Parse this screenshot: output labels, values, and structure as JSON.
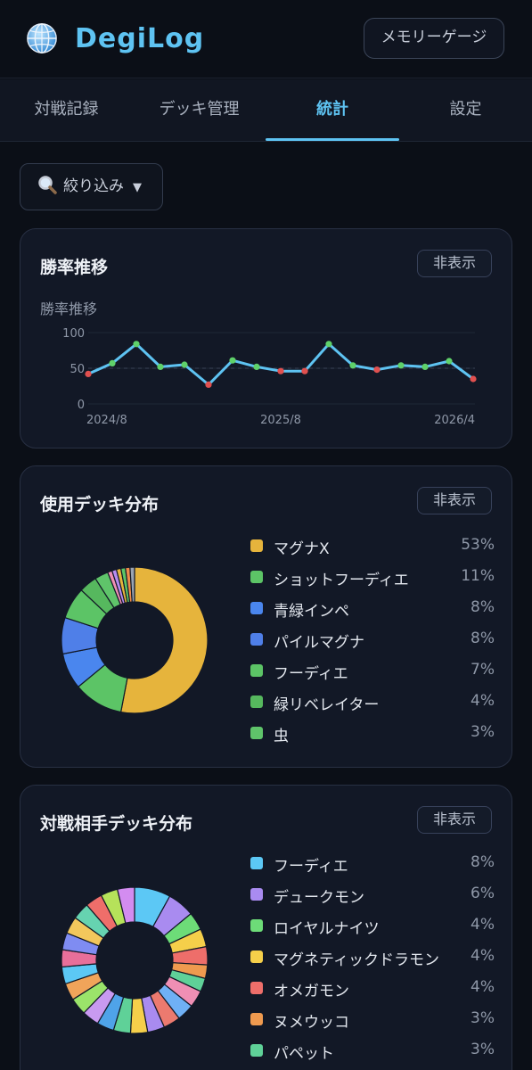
{
  "header": {
    "app_title": "DegiLog",
    "memory_button": "メモリーゲージ"
  },
  "tabs": [
    {
      "label": "対戦記録"
    },
    {
      "label": "デッキ管理"
    },
    {
      "label": "統計",
      "active": true
    },
    {
      "label": "設定"
    }
  ],
  "filter": {
    "label": "絞り込み",
    "caret": "▼"
  },
  "win_rate_card": {
    "title": "勝率推移",
    "hide_label": "非表示",
    "subtitle": "勝率推移"
  },
  "deck_usage_card": {
    "title": "使用デッキ分布",
    "hide_label": "非表示"
  },
  "opponent_card": {
    "title": "対戦相手デッキ分布",
    "hide_label": "非表示"
  },
  "chart_data": [
    {
      "type": "line",
      "title": "勝率推移",
      "y_ticks": [
        "100",
        "50",
        "0"
      ],
      "ylim": [
        0,
        100
      ],
      "x_tick_labels": [
        "2024/8",
        "2025/8",
        "2026/4"
      ],
      "x_tick_index": [
        0,
        8,
        16
      ],
      "reference_line": 50,
      "values": [
        42,
        57,
        84,
        52,
        55,
        27,
        61,
        52,
        46,
        46,
        84,
        54,
        48,
        54,
        52,
        60,
        35
      ],
      "line_color": "#5ec3f2",
      "above_color": "#5fd16a",
      "below_color": "#e0504f"
    },
    {
      "type": "pie",
      "title": "使用デッキ分布",
      "slices": [
        {
          "name": "マグナX",
          "value": 53,
          "label": "53%",
          "color": "#e6b43c"
        },
        {
          "name": "ショットフーディエ",
          "value": 11,
          "label": "11%",
          "color": "#5cc466"
        },
        {
          "name": "青緑インペ",
          "value": 8,
          "label": "8%",
          "color": "#4a86ee"
        },
        {
          "name": "パイルマグナ",
          "value": 8,
          "label": "8%",
          "color": "#4f7fe8"
        },
        {
          "name": "フーディエ",
          "value": 7,
          "label": "7%",
          "color": "#5cc466"
        },
        {
          "name": "緑リベレイター",
          "value": 4,
          "label": "4%",
          "color": "#56b85e"
        },
        {
          "name": "虫",
          "value": 3,
          "label": "3%",
          "color": "#5fc46a"
        }
      ],
      "minor_slice_colors": [
        "#ef8fb4",
        "#b58cf0",
        "#e6b43c",
        "#5cc466",
        "#ef8b4a",
        "#9aa3b2"
      ]
    },
    {
      "type": "pie",
      "title": "対戦相手デッキ分布",
      "slices": [
        {
          "name": "フーディエ",
          "value": 8,
          "label": "8%",
          "color": "#5cc8f5"
        },
        {
          "name": "デュークモン",
          "value": 6,
          "label": "6%",
          "color": "#a98bf0"
        },
        {
          "name": "ロイヤルナイツ",
          "value": 4,
          "label": "4%",
          "color": "#6ddc78"
        },
        {
          "name": "マグネティックドラモン",
          "value": 4,
          "label": "4%",
          "color": "#f5cf4a"
        },
        {
          "name": "オメガモン",
          "value": 4,
          "label": "4%",
          "color": "#ee6e6a"
        },
        {
          "name": "ヌメウッコ",
          "value": 3,
          "label": "3%",
          "color": "#ef9a4f"
        },
        {
          "name": "パペット",
          "value": 3,
          "label": "3%",
          "color": "#5fd198"
        }
      ],
      "minor_slice_colors": [
        "#ef8fb4",
        "#6fb0f5",
        "#ec7a6f",
        "#a98bf0",
        "#f5cf4a",
        "#5fd198",
        "#4fa3e8",
        "#c89af0",
        "#9be36a",
        "#f0a45a",
        "#5cc8f5",
        "#e86f9a",
        "#7f8cf2",
        "#f2c75c",
        "#66d3b0",
        "#ef6e6a",
        "#b6e25a",
        "#d38cf0"
      ]
    }
  ]
}
